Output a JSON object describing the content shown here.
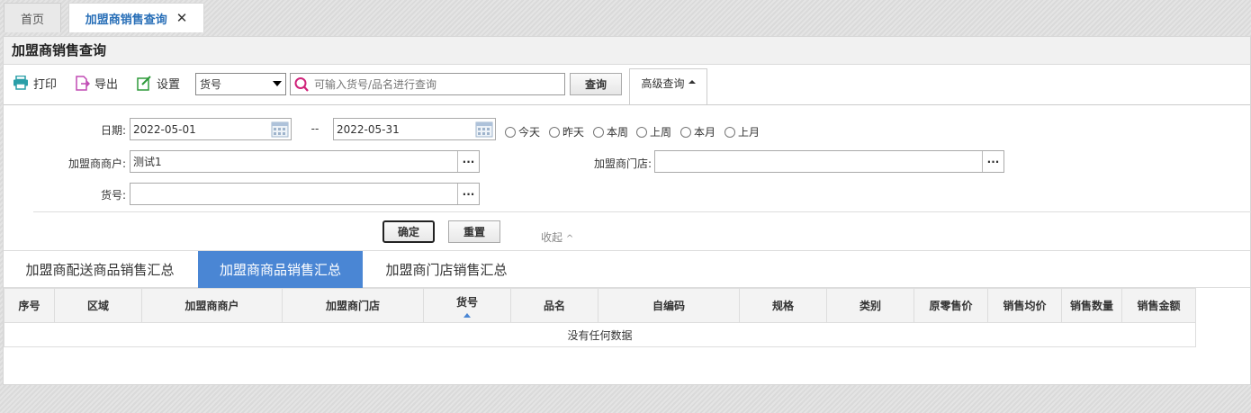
{
  "tabs": {
    "home": "首页",
    "active": "加盟商销售查询",
    "close_glyph": "✕"
  },
  "page": {
    "title": "加盟商销售查询"
  },
  "toolbar": {
    "print": "打印",
    "export": "导出",
    "settings": "设置",
    "field_select": "货号",
    "search_placeholder": "可输入货号/品名进行查询",
    "query": "查询",
    "advanced": "高级查询"
  },
  "filters": {
    "date_label": "日期:",
    "date_from": "2022-05-01",
    "date_sep": "--",
    "date_to": "2022-05-31",
    "quick_ranges": [
      "今天",
      "昨天",
      "本周",
      "上周",
      "本月",
      "上月"
    ],
    "merchant_label": "加盟商商户:",
    "merchant_value": "测试1",
    "store_label": "加盟商门店:",
    "store_value": "",
    "sku_label": "货号:",
    "sku_value": "",
    "dots": "···",
    "confirm": "确定",
    "reset": "重置",
    "collapse": "收起",
    "collapse_glyph": "^"
  },
  "subtabs": [
    "加盟商配送商品销售汇总",
    "加盟商商品销售汇总",
    "加盟商门店销售汇总"
  ],
  "table": {
    "columns": [
      "序号",
      "区域",
      "加盟商商户",
      "加盟商门店",
      "货号",
      "品名",
      "自编码",
      "规格",
      "类别",
      "原零售价",
      "销售均价",
      "销售数量",
      "销售金额"
    ],
    "empty_text": "没有任何数据"
  },
  "colors": {
    "accent": "#4a86d4",
    "tab_text": "#2a70b8"
  }
}
